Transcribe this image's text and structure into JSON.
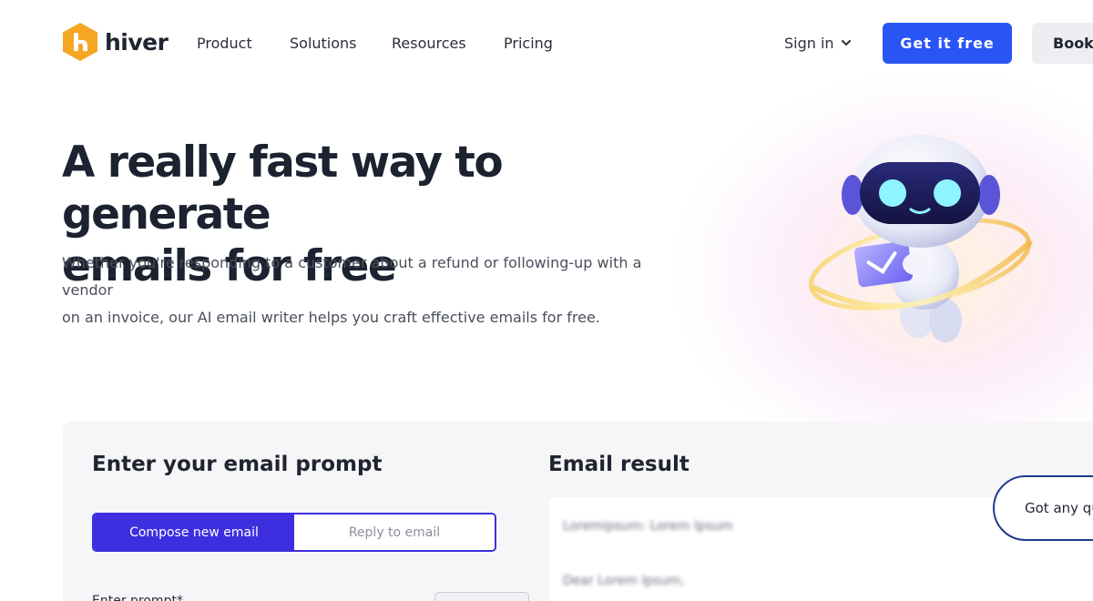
{
  "brand": {
    "name": "hiver",
    "logo_color": "#f5a623"
  },
  "nav": {
    "links": [
      "Product",
      "Solutions",
      "Resources",
      "Pricing"
    ],
    "sign_in": "Sign in",
    "get_free": "Get it free",
    "book": "Book a"
  },
  "hero": {
    "title_line1": "A really fast way to generate",
    "title_line2": "emails for free",
    "subtitle_line1": "Whether you're responding to a customer about a refund or following-up with a vendor",
    "subtitle_line2": "on an invoice, our AI email writer helps you craft effective emails for free."
  },
  "tool": {
    "prompt_heading": "Enter your email prompt",
    "result_heading": "Email result",
    "tabs": [
      {
        "label": "Compose new email",
        "active": true
      },
      {
        "label": "Reply to email",
        "active": false
      }
    ],
    "field_label": "Enter prompt*",
    "result_lines": [
      "Loremipsum: Lorem Ipsum",
      "Dear Lorem Ipsum,"
    ]
  },
  "chat": {
    "label": "Got any questions?"
  },
  "colors": {
    "primary": "#2a55f5",
    "accent": "#3d2fe0",
    "brand": "#f5a623"
  }
}
